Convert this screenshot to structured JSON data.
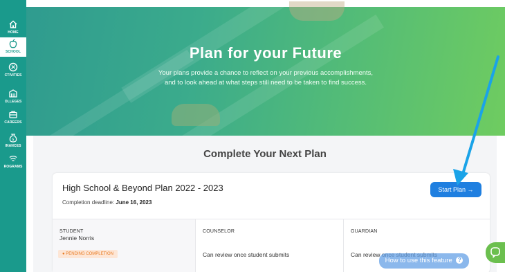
{
  "sidebar": {
    "items": [
      {
        "label": "HOME",
        "icon": "home-icon",
        "active": false
      },
      {
        "label": "SCHOOL",
        "icon": "apple-icon",
        "active": true
      },
      {
        "label": "CTIVITIES",
        "icon": "activities-icon",
        "active": false
      },
      {
        "label": "OLLEGES",
        "icon": "college-icon",
        "active": false
      },
      {
        "label": "CAREERS",
        "icon": "briefcase-icon",
        "active": false
      },
      {
        "label": "INANCES",
        "icon": "money-bag-icon",
        "active": false
      },
      {
        "label": "ROGRAMS",
        "icon": "programs-icon",
        "active": false
      }
    ]
  },
  "hero": {
    "title": "Plan for your Future",
    "subtitle_line1": "Your plans provide a chance to reflect on your previous accomplishments,",
    "subtitle_line2": "and to look ahead at what steps still need to be taken to find success."
  },
  "main": {
    "section_title": "Complete Your Next Plan",
    "plan": {
      "title": "High School & Beyond Plan 2022 - 2023",
      "deadline_label": "Completion deadline:",
      "deadline_date": "June 16, 2023",
      "start_button": "Start Plan →",
      "roles": [
        {
          "header": "STUDENT",
          "name": "Jennie Norris",
          "badge": "● PENDING COMPLETION"
        },
        {
          "header": "COUNSELOR",
          "note": "Can review once student submits"
        },
        {
          "header": "GUARDIAN",
          "note": "Can review once student submits"
        }
      ]
    }
  },
  "help": {
    "label": "How to use this feature",
    "icon": "question-icon"
  },
  "chat": {
    "icon": "chat-icon"
  },
  "colors": {
    "sidebar": "#1a9a8c",
    "accent_button": "#1f7fe0",
    "badge_text": "#e8781e",
    "badge_bg": "#fde6d6",
    "annotation_arrow": "#1aa3e8"
  }
}
